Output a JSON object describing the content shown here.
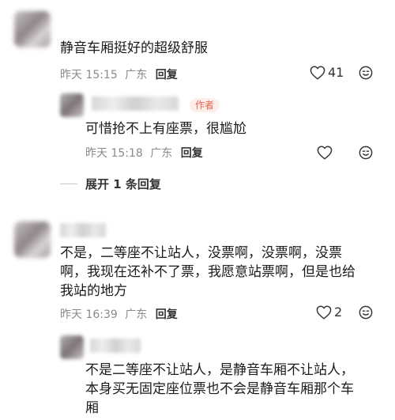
{
  "comments": [
    {
      "text": "静音车厢挺好的超级舒服",
      "time": "昨天 15:15",
      "location": "广东",
      "reply_label": "回复",
      "likes": "41"
    },
    {
      "author_tag": "作者",
      "text": "可惜抢不上有座票，很尴尬",
      "time": "昨天 15:18",
      "location": "广东",
      "reply_label": "回复"
    },
    {
      "expand_label": "展开 1 条回复"
    },
    {
      "lines": [
        "不是，二等座不让站人，没票啊，没票啊，没票",
        "啊，我现在还补不了票，我愿意站票啊，但是也给",
        "我站的地方"
      ],
      "time": "昨天 16:39",
      "location": "广东",
      "reply_label": "回复",
      "likes": "2"
    },
    {
      "lines": [
        "不是二等座不让站人，是静音车厢不让站人，",
        "本身买无固定座位票也不会是静音车厢那个车",
        "厢"
      ]
    }
  ],
  "icons": {
    "like": "heart-outline-icon",
    "emoji": "emoji-face-icon"
  },
  "colors": {
    "author_tag_text": "#e8614a",
    "author_tag_bg": "#fdeeea",
    "meta_text": "#8a8a8a"
  }
}
